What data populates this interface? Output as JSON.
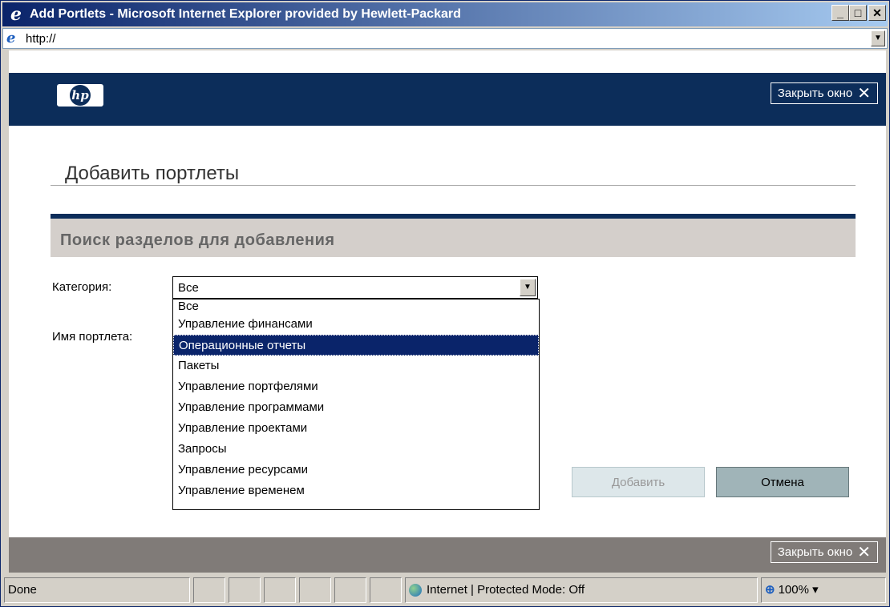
{
  "window": {
    "title": "Add Portlets - Microsoft Internet Explorer provided by Hewlett-Packard",
    "address": "http://"
  },
  "header": {
    "close_label": "Закрыть окно"
  },
  "page": {
    "title": "Добавить портлеты",
    "section_title": "Поиск разделов для добавления",
    "category_label": "Категория:",
    "portlet_name_label": "Имя портлета:",
    "category_selected": "Все",
    "category_options": [
      "Все",
      "Управление финансами",
      "Операционные отчеты",
      "Пакеты",
      "Управление портфелями",
      "Управление программами",
      "Управление проектами",
      "Запросы",
      "Управление ресурсами",
      "Управление временем"
    ],
    "highlighted_option": "Операционные отчеты",
    "add_button": "Добавить",
    "cancel_button": "Отмена"
  },
  "footer": {
    "close_label": "Закрыть окно"
  },
  "statusbar": {
    "status": "Done",
    "zone": "Internet | Protected Mode: Off",
    "zoom": "100%"
  }
}
